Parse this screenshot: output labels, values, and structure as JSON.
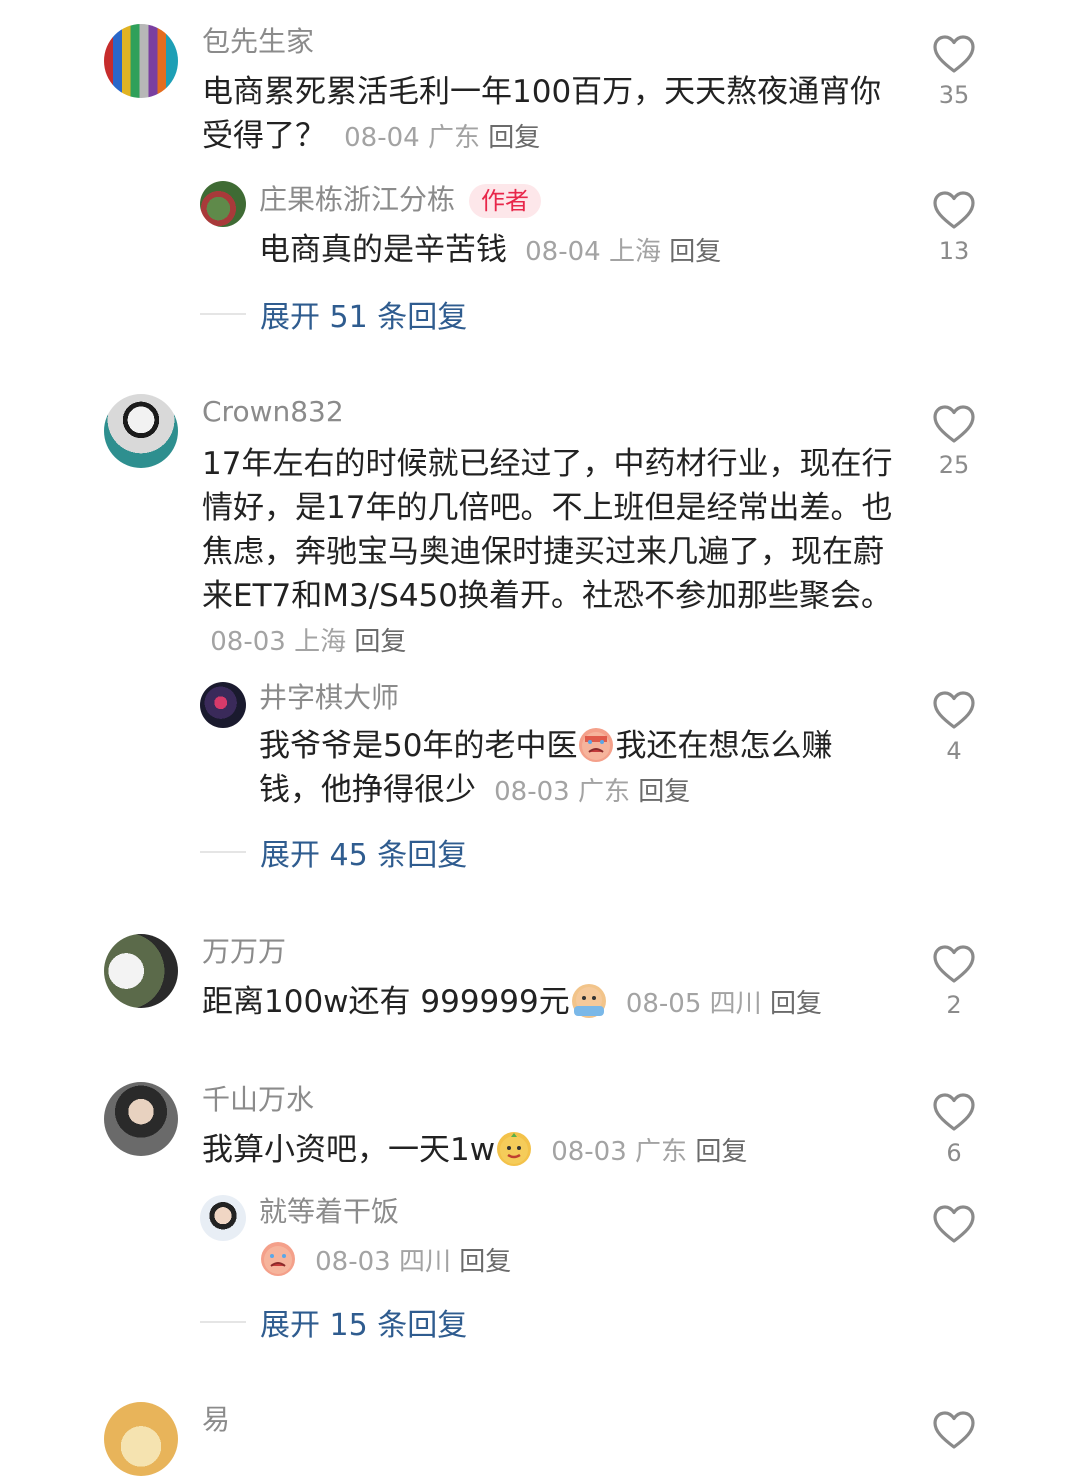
{
  "comments": [
    {
      "username": "包先生家",
      "text": "电商累死累活毛利一年100百万，天天熬夜通宵你受得了？",
      "date": "08-04",
      "location": "广东",
      "reply": "回复",
      "likes": "35",
      "replies": [
        {
          "username": "庄果栋浙江分栋",
          "tag": "作者",
          "text": "电商真的是辛苦钱",
          "date": "08-04",
          "location": "上海",
          "reply": "回复",
          "likes": "13"
        }
      ],
      "expand": "展开 51 条回复"
    },
    {
      "username": "Crown832",
      "text": "17年左右的时候就已经过了，中药材行业，现在行情好，是17年的几倍吧。不上班但是经常出差。也焦虑，奔驰宝马奥迪保时捷买过来几遍了，现在蔚来ET7和M3/S450换着开。社恐不参加那些聚会。",
      "date": "08-03",
      "location": "上海",
      "reply": "回复",
      "likes": "25",
      "replies": [
        {
          "username": "井字棋大师",
          "text_a": "我爷爷是50年的老中医",
          "text_b": "我还在想怎么赚钱，他挣得很少",
          "date": "08-03",
          "location": "广东",
          "reply": "回复",
          "likes": "4"
        }
      ],
      "expand": "展开 45 条回复"
    },
    {
      "username": "万万万",
      "text": "距离100w还有 999999元",
      "date": "08-05",
      "location": "四川",
      "reply": "回复",
      "likes": "2"
    },
    {
      "username": "千山万水",
      "text": "我算小资吧，一天1w",
      "date": "08-03",
      "location": "广东",
      "reply": "回复",
      "likes": "6",
      "replies": [
        {
          "username": "就等着干饭",
          "date": "08-03",
          "location": "四川",
          "reply": "回复",
          "likes": ""
        }
      ],
      "expand": "展开 15 条回复"
    },
    {
      "username": "易"
    }
  ],
  "icons": {
    "like": "heart-outline-icon",
    "emoji_crying": "crying-face-emoji",
    "emoji_sweat": "sweating-face-emoji",
    "emoji_smug": "smug-face-emoji"
  },
  "colors": {
    "expand_link": "#2f5c8f",
    "author_tag_bg": "#fde7ea",
    "author_tag_text": "#e8274a",
    "meta_text": "#a3a3a3"
  }
}
